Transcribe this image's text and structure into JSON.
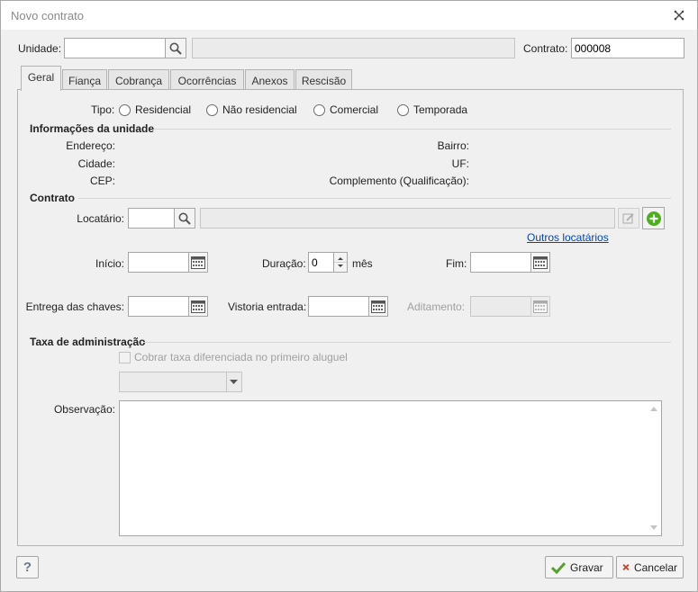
{
  "window": {
    "title": "Novo contrato"
  },
  "top": {
    "unidade_label": "Unidade:",
    "unidade_value": "",
    "contrato_label": "Contrato:",
    "contrato_value": "000008"
  },
  "tabs": [
    {
      "label": "Geral",
      "active": true
    },
    {
      "label": "Fiança"
    },
    {
      "label": "Cobrança"
    },
    {
      "label": "Ocorrências"
    },
    {
      "label": "Anexos"
    },
    {
      "label": "Rescisão"
    }
  ],
  "geral": {
    "tipo_label": "Tipo:",
    "tipo_options": [
      "Residencial",
      "Não residencial",
      "Comercial",
      "Temporada"
    ],
    "info_section": "Informações da unidade",
    "endereco_label": "Endereço:",
    "cidade_label": "Cidade:",
    "cep_label": "CEP:",
    "bairro_label": "Bairro:",
    "uf_label": "UF:",
    "complemento_label": "Complemento (Qualificação):",
    "contrato_section": "Contrato",
    "locatario_label": "Locatário:",
    "outros_locatarios": "Outros locatários",
    "inicio_label": "Início:",
    "duracao_label": "Duração:",
    "duracao_value": "0",
    "mes_label": "mês",
    "fim_label": "Fim:",
    "entrega_label": "Entrega das chaves:",
    "vistoria_label": "Vistoria entrada:",
    "aditamento_label": "Aditamento:",
    "taxa_section": "Taxa de administração",
    "cobrar_taxa_label": "Cobrar taxa diferenciada no primeiro aluguel",
    "observacao_label": "Observação:"
  },
  "footer": {
    "help_label": "?",
    "save_label": "Gravar",
    "cancel_label": "Cancelar"
  },
  "colors": {
    "save_check": "#5aa02c",
    "cancel_x": "#d23a2a",
    "add_green": "#4caf1e",
    "link": "#0645ad"
  }
}
